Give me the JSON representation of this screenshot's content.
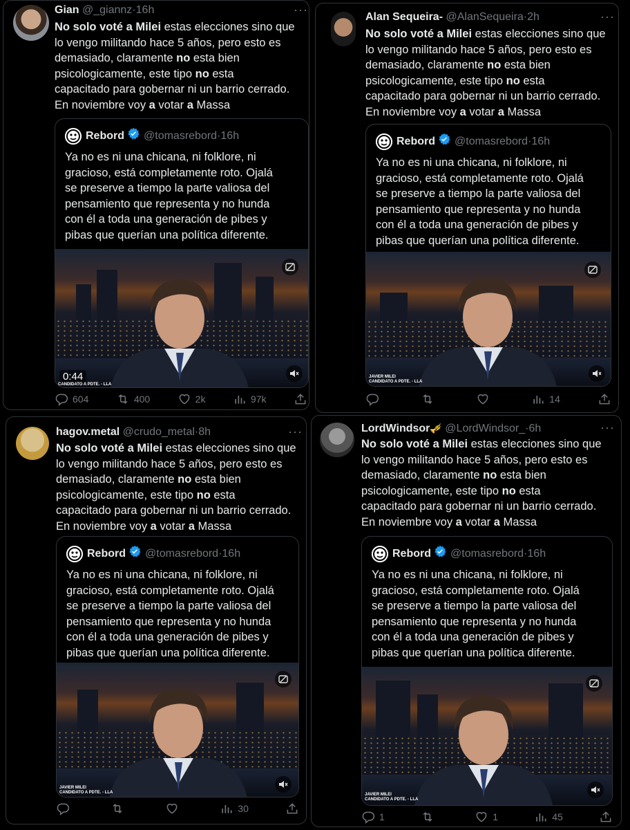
{
  "tweets": [
    {
      "name": "Gian",
      "handle": "@_giannz",
      "time": "16h",
      "body_lines": [
        [
          "No solo voté a Milei",
          " estas elecciones sino que"
        ],
        [
          "",
          "lo vengo militando hace 5 años, pero esto es"
        ],
        [
          "",
          "demasiado, claramente ",
          "no",
          " esta bien"
        ],
        [
          "",
          "psicologicamente, este tipo ",
          "no",
          " esta"
        ],
        [
          "",
          "capacitado para gobernar ni un barrio cerrado."
        ],
        [
          "",
          "En noviembre voy ",
          "a",
          " votar ",
          "a",
          " Massa"
        ]
      ],
      "video_duration": "0:44",
      "stats": {
        "replies": "604",
        "retweets": "400",
        "likes": "2k",
        "views": "97k"
      }
    },
    {
      "name": "Alan Sequeira-",
      "handle": "@AlanSequeira",
      "time": "2h",
      "stats": {
        "replies": "",
        "retweets": "",
        "likes": "",
        "views": "14"
      }
    },
    {
      "name": "hagov.metal",
      "handle": "@crudo_metal",
      "time": "8h",
      "stats": {
        "replies": "",
        "retweets": "",
        "likes": "",
        "views": "30"
      }
    },
    {
      "name": "LordWindsor",
      "name_emoji": "🎺",
      "handle": "@LordWindsor_",
      "time": "6h",
      "stats": {
        "replies": "1",
        "retweets": "",
        "likes": "1",
        "views": "45"
      }
    }
  ],
  "quote": {
    "name": "Rebord",
    "handle": "@tomasrebord",
    "time": "16h",
    "lines": [
      "Ya no es ni una chicana, ni folklore, ni",
      "gracioso, está completamente roto. Ojalá",
      "se preserve a tiempo la parte valiosa del",
      "pensamiento que representa y no hunda",
      "con él a toda una generación de pibes y",
      "pibas que querían una política diferente."
    ]
  },
  "video_caption": {
    "name": "JAVIER MILEI",
    "role": "CANDIDATO A PDTE. - LLA"
  },
  "colors": {
    "bg": "#000000",
    "text": "#e7e9ea",
    "muted": "#71767b",
    "verified": "#1d9bf0",
    "border": "#2f3336"
  }
}
